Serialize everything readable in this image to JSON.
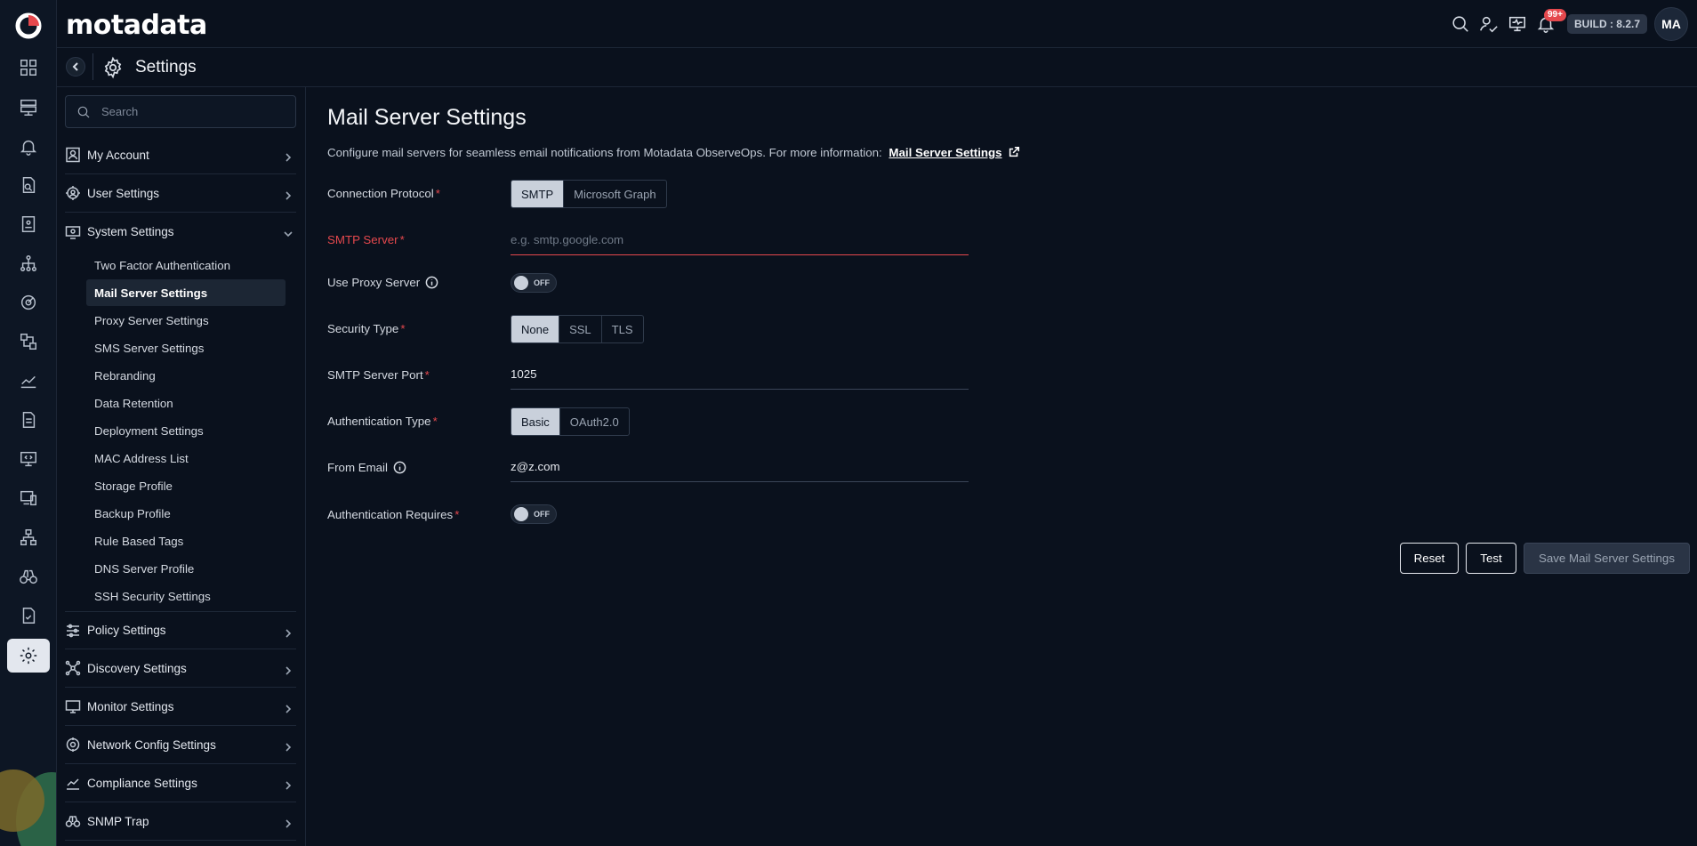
{
  "app": {
    "brand": "motadata",
    "build": "BUILD : 8.2.7",
    "notifications_count": "99+",
    "user_initials": "MA"
  },
  "header": {
    "title": "Settings"
  },
  "sidebar": {
    "search_placeholder": "Search",
    "sections": [
      {
        "label": "My Account",
        "icon": "user-card-icon"
      },
      {
        "label": "User Settings",
        "icon": "users-gear-icon"
      },
      {
        "label": "System Settings",
        "icon": "monitor-gear-icon",
        "expanded": true
      },
      {
        "label": "Policy Settings",
        "icon": "sliders-icon"
      },
      {
        "label": "Discovery Settings",
        "icon": "discovery-icon"
      },
      {
        "label": "Monitor Settings",
        "icon": "monitor-icon"
      },
      {
        "label": "Network Config Settings",
        "icon": "network-config-icon"
      },
      {
        "label": "Compliance Settings",
        "icon": "compliance-icon"
      },
      {
        "label": "SNMP Trap",
        "icon": "binoculars-icon"
      }
    ],
    "system_items": [
      "Two Factor Authentication",
      "Mail Server Settings",
      "Proxy Server Settings",
      "SMS Server Settings",
      "Rebranding",
      "Data Retention",
      "Deployment Settings",
      "MAC Address List",
      "Storage Profile",
      "Backup Profile",
      "Rule Based Tags",
      "DNS Server Profile",
      "SSH Security Settings"
    ],
    "active_item": "Mail Server Settings"
  },
  "main": {
    "title": "Mail Server Settings",
    "description": "Configure mail servers for seamless email notifications from Motadata ObserveOps. For more information:",
    "link_text": "Mail Server Settings",
    "fields": {
      "connection_protocol": {
        "label": "Connection Protocol",
        "options": [
          "SMTP",
          "Microsoft Graph"
        ],
        "selected": "SMTP"
      },
      "smtp_server": {
        "label": "SMTP Server",
        "value": "",
        "placeholder": "e.g. smtp.google.com"
      },
      "use_proxy": {
        "label": "Use Proxy Server",
        "state": "OFF"
      },
      "security_type": {
        "label": "Security Type",
        "options": [
          "None",
          "SSL",
          "TLS"
        ],
        "selected": "None"
      },
      "smtp_port": {
        "label": "SMTP Server Port",
        "value": "1025"
      },
      "auth_type": {
        "label": "Authentication Type",
        "options": [
          "Basic",
          "OAuth2.0"
        ],
        "selected": "Basic"
      },
      "from_email": {
        "label": "From Email",
        "value": "z@z.com"
      },
      "auth_requires": {
        "label": "Authentication Requires",
        "state": "OFF"
      }
    },
    "buttons": {
      "reset": "Reset",
      "test": "Test",
      "save": "Save Mail Server Settings"
    }
  },
  "colors": {
    "background": "#0a111d",
    "error": "#e5484d",
    "selected_segment": "#c9d0db"
  }
}
